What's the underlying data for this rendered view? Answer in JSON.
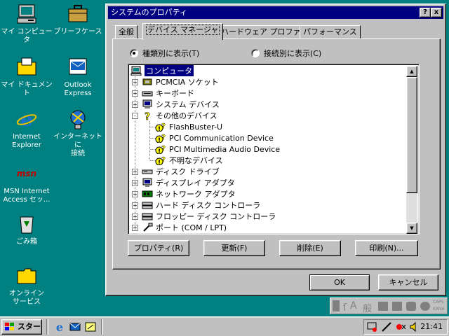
{
  "desktop": {
    "icons": [
      {
        "label": "マイ コンピュータ"
      },
      {
        "label": "ブリーフケース"
      },
      {
        "label": "マイ ドキュメント"
      },
      {
        "label": "Outlook\nExpress"
      },
      {
        "label": "Internet\nExplorer"
      },
      {
        "label": "インターネットに\n接続"
      },
      {
        "label": "MSN Internet\nAccess セッ..."
      },
      {
        "label": "ごみ箱"
      },
      {
        "label": "オンライン\nサービス"
      }
    ]
  },
  "window": {
    "title": "システムのプロパティ",
    "help_label": "?",
    "close_label": "x",
    "tabs": [
      {
        "label": "全般"
      },
      {
        "label": "デバイス マネージャ"
      },
      {
        "label": "ハードウェア プロファイル"
      },
      {
        "label": "パフォーマンス"
      }
    ],
    "radio_by_type": "種類別に表示(T)",
    "radio_by_connection": "接続別に表示(C)",
    "tree": {
      "root": "コンピュータ",
      "items": [
        {
          "label": "PCMCIA ソケット",
          "expander": "+"
        },
        {
          "label": "キーボード",
          "expander": "+"
        },
        {
          "label": "システム デバイス",
          "expander": "+"
        },
        {
          "label": "その他のデバイス",
          "expander": "-"
        },
        {
          "label": "FlashBuster-U",
          "child": true
        },
        {
          "label": "PCI Communication Device",
          "child": true
        },
        {
          "label": "PCI Multimedia Audio Device",
          "child": true
        },
        {
          "label": "不明なデバイス",
          "child": true
        },
        {
          "label": "ディスク ドライブ",
          "expander": "+"
        },
        {
          "label": "ディスプレイ アダプタ",
          "expander": "+"
        },
        {
          "label": "ネットワーク アダプタ",
          "expander": "+"
        },
        {
          "label": "ハード ディスク コントローラ",
          "expander": "+"
        },
        {
          "label": "フロッピー ディスク コントローラ",
          "expander": "+"
        },
        {
          "label": "ポート (COM / LPT)",
          "expander": "+"
        }
      ]
    },
    "buttons": {
      "properties": "プロパティ(R)",
      "refresh": "更新(F)",
      "remove": "削除(E)",
      "print": "印刷(N)...",
      "ok": "OK",
      "cancel": "キャンセル"
    }
  },
  "ime_bar": {
    "mode": "A",
    "dict": "般",
    "caps": "CAPS",
    "kana": "KANA"
  },
  "taskbar": {
    "start_label": "スタート",
    "clock": "21:41"
  },
  "colors": {
    "desktop": "#008080",
    "titlebar": "#000080",
    "face": "#c0c0c0",
    "warning": "#ffff00"
  }
}
